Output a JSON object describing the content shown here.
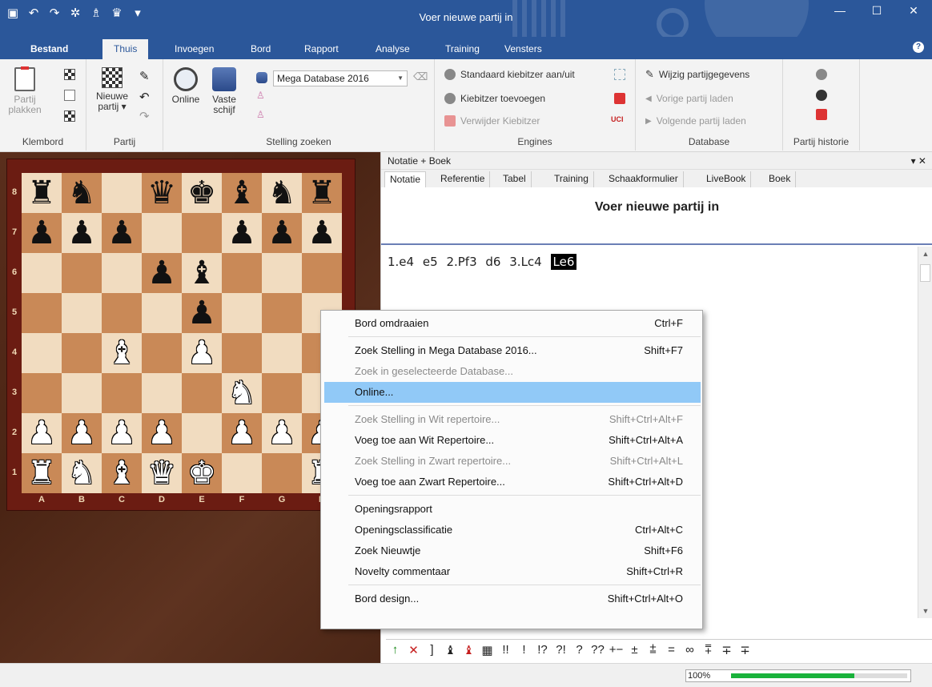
{
  "window": {
    "title": "Voer nieuwe partij in",
    "controls": [
      "minimize",
      "maximize",
      "close"
    ]
  },
  "ribbon_tabs": [
    "Bestand",
    "Thuis",
    "Invoegen",
    "Bord",
    "Rapport",
    "Analyse",
    "Training",
    "Vensters"
  ],
  "active_tab": "Thuis",
  "ribbon": {
    "klembord": {
      "label": "Klembord",
      "paste_line1": "Partij",
      "paste_line2": "plakken"
    },
    "partij": {
      "label": "Partij",
      "new_line1": "Nieuwe",
      "new_line2": "partij ▾"
    },
    "stelling": {
      "label": "Stelling zoeken",
      "online": "Online",
      "vaste_line1": "Vaste",
      "vaste_line2": "schijf",
      "database_combo": "Mega Database 2016"
    },
    "engines": {
      "label": "Engines",
      "std_kibitzer": "Standaard kiebitzer aan/uit",
      "add_kibitzer": "Kiebitzer toevoegen",
      "remove_kibitzer": "Verwijder Kiebitzer",
      "uci_badge": "UCI"
    },
    "database": {
      "label": "Database",
      "edit_game": "Wijzig partijgegevens",
      "prev_game": "Vorige partij laden",
      "next_game": "Volgende partij laden"
    },
    "historie": {
      "label": "Partij historie"
    }
  },
  "board": {
    "ranks": [
      "8",
      "7",
      "6",
      "5",
      "4",
      "3",
      "2",
      "1"
    ],
    "files": [
      "A",
      "B",
      "C",
      "D",
      "E",
      "F",
      "G",
      "H"
    ],
    "position": [
      [
        "bR",
        "bN",
        "",
        "bQ",
        "bK",
        "bB",
        "bN",
        "bR"
      ],
      [
        "bP",
        "bP",
        "bP",
        "",
        "",
        "bP",
        "bP",
        "bP"
      ],
      [
        "",
        "",
        "",
        "bP",
        "bB",
        "",
        "",
        ""
      ],
      [
        "",
        "",
        "",
        "",
        "bP",
        "",
        "",
        ""
      ],
      [
        "",
        "",
        "wB",
        "",
        "wP",
        "",
        "",
        ""
      ],
      [
        "",
        "",
        "",
        "",
        "",
        "wN",
        "",
        ""
      ],
      [
        "wP",
        "wP",
        "wP",
        "wP",
        "",
        "wP",
        "wP",
        "wP"
      ],
      [
        "wR",
        "wN",
        "wB",
        "wQ",
        "wK",
        "",
        "",
        "wR"
      ]
    ]
  },
  "notation_pane": {
    "header": "Notatie + Boek",
    "header_controls": "▾ ✕",
    "tabs": [
      "Notatie",
      "Referentie",
      "Tabel",
      "Training",
      "Schaakformulier",
      "LiveBook",
      "Boek"
    ],
    "active_tab": "Notatie",
    "title": "Voer nieuwe partij in",
    "moves": [
      "1.e4",
      "e5",
      "2.Pf3",
      "d6",
      "3.Lc4",
      "Le6"
    ],
    "selected_move": "Le6"
  },
  "symbol_bar": [
    "↑",
    "✕",
    "]",
    "♝",
    "♝",
    "▦",
    "!!",
    "!",
    "!?",
    "?!",
    "?",
    "??",
    "+−",
    "±",
    "⩲",
    "=",
    "∞",
    "⩱",
    "∓",
    "∓"
  ],
  "status": {
    "zoom_label": "100%",
    "zoom_fraction": 0.7
  },
  "context_menu": {
    "items": [
      {
        "label": "Bord omdraaien",
        "shortcut": "Ctrl+F",
        "disabled": false
      },
      {
        "label": "Zoek Stelling in Mega Database 2016...",
        "shortcut": "Shift+F7",
        "disabled": false
      },
      {
        "label": "Zoek in geselecteerde Database...",
        "shortcut": "",
        "disabled": true
      },
      {
        "label": "Online...",
        "shortcut": "",
        "disabled": false,
        "hover": true
      },
      {
        "label": "Zoek Stelling in Wit repertoire...",
        "shortcut": "Shift+Ctrl+Alt+F",
        "disabled": true
      },
      {
        "label": "Voeg toe aan Wit Repertoire...",
        "shortcut": "Shift+Ctrl+Alt+A",
        "disabled": false
      },
      {
        "label": "Zoek Stelling in Zwart repertoire...",
        "shortcut": "Shift+Ctrl+Alt+L",
        "disabled": true
      },
      {
        "label": "Voeg toe aan Zwart Repertoire...",
        "shortcut": "Shift+Ctrl+Alt+D",
        "disabled": false
      },
      {
        "label": "Openingsrapport",
        "shortcut": "",
        "disabled": false
      },
      {
        "label": "Openingsclassificatie",
        "shortcut": "Ctrl+Alt+C",
        "disabled": false
      },
      {
        "label": "Zoek Nieuwtje",
        "shortcut": "Shift+F6",
        "disabled": false
      },
      {
        "label": "Novelty commentaar",
        "shortcut": "Shift+Ctrl+R",
        "disabled": false
      },
      {
        "label": "Bord design...",
        "shortcut": "Shift+Ctrl+Alt+O",
        "disabled": false
      }
    ]
  },
  "colors": {
    "accent": "#2b579a",
    "menu_hover": "#91c9f7",
    "board_light": "#f1dcc0",
    "board_dark": "#c98957",
    "frame": "#6b1c12",
    "zoom_fill": "#19b23b"
  }
}
